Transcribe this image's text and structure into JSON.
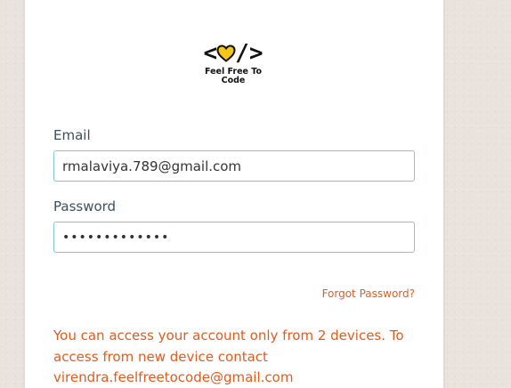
{
  "brand": {
    "logo_text": "Feel Free To Code",
    "heart_color": "#f5c518"
  },
  "form": {
    "email_label": "Email",
    "email_value": "rmalaviya.789@gmail.com",
    "password_label": "Password",
    "password_value": "•••••••••••••",
    "forgot_password": "Forgot Password?"
  },
  "notice": {
    "text": "You can access your account only from 2 devices. To access from new device contact virendra.feelfreetocode@gmail.com"
  },
  "colors": {
    "accent_orange": "#e25b1d",
    "input_border": "#7ec8d6"
  }
}
